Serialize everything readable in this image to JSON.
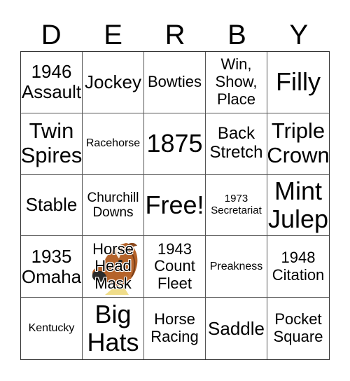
{
  "card": {
    "title_letters": [
      "D",
      "E",
      "R",
      "B",
      "Y"
    ],
    "cells": [
      {
        "text": "1946\nAssault",
        "size": "fs-m"
      },
      {
        "text": "Jockey",
        "size": "fs-m"
      },
      {
        "text": "Bowties",
        "size": "fs-s"
      },
      {
        "text": "Win,\nShow,\nPlace",
        "size": "fs-s"
      },
      {
        "text": "Filly",
        "size": "fs-xl"
      },
      {
        "text": "Twin\nSpires",
        "size": "fs-l"
      },
      {
        "text": "Racehorse",
        "size": "fs-xxs"
      },
      {
        "text": "1875",
        "size": "fs-xl"
      },
      {
        "text": "Back\nStretch",
        "size": "fs-ms"
      },
      {
        "text": "Triple\nCrown",
        "size": "fs-l"
      },
      {
        "text": "Stable",
        "size": "fs-m"
      },
      {
        "text": "Churchill\nDowns",
        "size": "fs-xs"
      },
      {
        "text": "Free!",
        "size": "fs-xl"
      },
      {
        "text": "1973\nSecretariat",
        "size": "fs-tiny"
      },
      {
        "text": "Mint\nJulep",
        "size": "fs-xl"
      },
      {
        "text": "1935\nOmaha",
        "size": "fs-m"
      },
      {
        "text": "Horse\nHead\nMask",
        "size": "fs-s",
        "image": "horse-head-mask"
      },
      {
        "text": "1943\nCount\nFleet",
        "size": "fs-s"
      },
      {
        "text": "Preakness",
        "size": "fs-xxs"
      },
      {
        "text": "1948\nCitation",
        "size": "fs-s"
      },
      {
        "text": "Kentucky",
        "size": "fs-xxs"
      },
      {
        "text": "Big\nHats",
        "size": "fs-xl"
      },
      {
        "text": "Horse\nRacing",
        "size": "fs-s"
      },
      {
        "text": "Saddle",
        "size": "fs-m"
      },
      {
        "text": "Pocket\nSquare",
        "size": "fs-s"
      }
    ]
  }
}
